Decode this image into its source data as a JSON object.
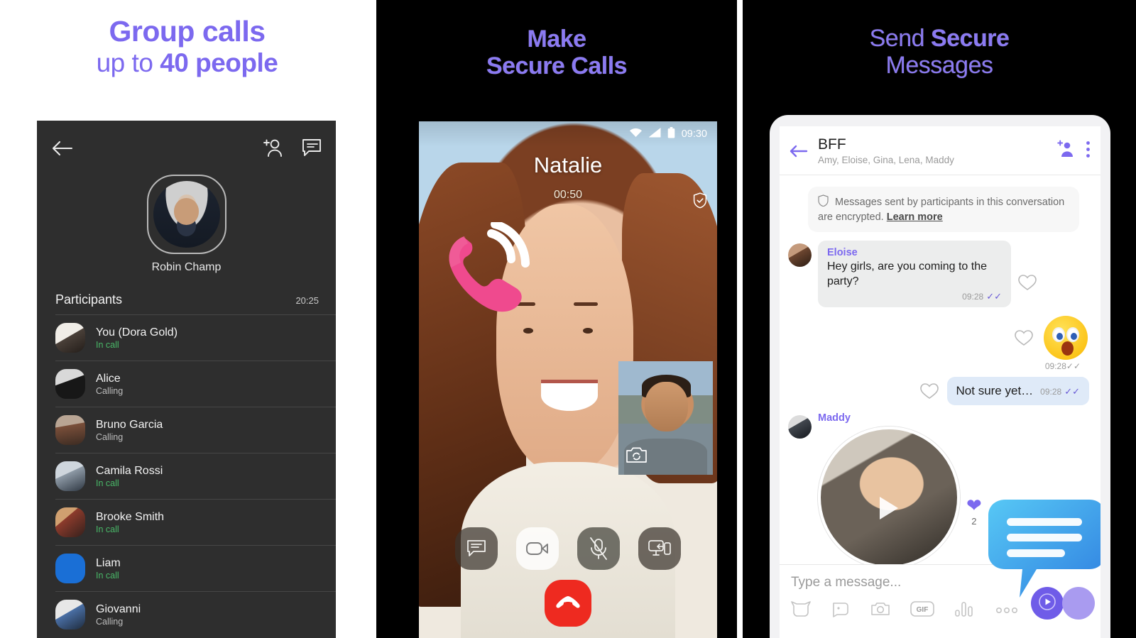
{
  "panels": [
    {
      "headline_line1": "Group calls",
      "headline_line2_prefix": "up to ",
      "headline_line2_bold": "40 people",
      "app": {
        "back_icon": "back-arrow-icon",
        "add_participant_icon": "add-person-icon",
        "chat_icon": "chat-bubble-icon",
        "caller_name": "Robin Champ",
        "section_title": "Participants",
        "section_time": "20:25",
        "participants": [
          {
            "name": "You (Dora Gold)",
            "status": "In call",
            "state": "incall"
          },
          {
            "name": "Alice",
            "status": "Calling",
            "state": "calling"
          },
          {
            "name": "Bruno Garcia",
            "status": "Calling",
            "state": "calling"
          },
          {
            "name": "Camila Rossi",
            "status": "In call",
            "state": "incall"
          },
          {
            "name": "Brooke Smith",
            "status": "In call",
            "state": "incall"
          },
          {
            "name": "Liam",
            "status": "In call",
            "state": "incall"
          },
          {
            "name": "Giovanni",
            "status": "Calling",
            "state": "calling"
          }
        ]
      }
    },
    {
      "headline_line1": "Make",
      "headline_line2": "Secure Calls",
      "call": {
        "status_time": "09:30",
        "wifi_icon": "wifi-icon",
        "signal_icon": "cellular-signal-icon",
        "battery_icon": "battery-icon",
        "callee_name": "Natalie",
        "timer": "00:50",
        "shield_icon": "shield-secure-icon",
        "flip_camera_icon": "flip-camera-icon",
        "controls": [
          {
            "icon": "chat-bubble-icon",
            "name": "chat-button"
          },
          {
            "icon": "video-camera-icon",
            "name": "video-toggle-button"
          },
          {
            "icon": "microphone-muted-icon",
            "name": "mute-button"
          },
          {
            "icon": "transfer-to-device-icon",
            "name": "transfer-call-button"
          }
        ],
        "end_call_icon": "end-call-handset-icon"
      }
    },
    {
      "headline_line1_light": "Send ",
      "headline_line1_bold": "Secure",
      "headline_line2": "Messages",
      "chat": {
        "back_icon": "back-arrow-icon",
        "title": "BFF",
        "subtitle": "Amy, Eloise, Gina, Lena, Maddy",
        "add_participant_icon": "add-person-icon",
        "overflow_icon": "more-vertical-icon",
        "encryption_notice": "Messages sent by participants in this conversation are encrypted.",
        "encryption_link": "Learn more",
        "shield_icon": "shield-outline-icon",
        "messages": [
          {
            "kind": "incoming-text",
            "sender": "Eloise",
            "text": "Hey girls, are you coming to the party?",
            "time": "09:28",
            "tick": "✓✓"
          },
          {
            "kind": "outgoing-emoji",
            "emoji": "astonished-face-emoji",
            "time": "09:28",
            "tick": "✓✓"
          },
          {
            "kind": "outgoing-text",
            "text": "Not sure yet…",
            "time": "09:28",
            "tick": "✓✓"
          },
          {
            "kind": "incoming-video",
            "sender": "Maddy",
            "play_icon": "play-icon",
            "reaction_icon": "heart-filled-icon",
            "reaction_count": "2"
          }
        ],
        "input_placeholder": "Type a message...",
        "input_icons": [
          "sticker-icon",
          "emoji-icon",
          "camera-icon",
          "gif-icon",
          "voice-waveform-icon",
          "more-horizontal-icon"
        ],
        "send_icon": "send-play-icon"
      }
    }
  ],
  "colors": {
    "brand_purple": "#7c69ef",
    "band_purple": "#9381f5",
    "app_dark": "#2e2e2e",
    "in_call_green": "#49b868",
    "end_call_red": "#ee2a20",
    "outgoing_bubble": "#dfeaf8",
    "incoming_bubble": "#eceded"
  }
}
